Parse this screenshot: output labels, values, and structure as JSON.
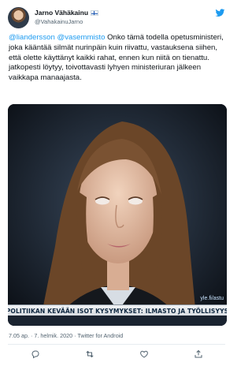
{
  "author": {
    "display_name": "Jarno Vähäkainu",
    "flag_icon": "finnish-flag-icon",
    "handle": "@VahakainuJarno"
  },
  "tweet": {
    "mention_1": "@liandersson",
    "mention_2": "@vasemmisto",
    "text": "Onko tämä todella opetusministeri, joka kääntää silmät nurinpäin kuin riivattu, vastauksena siihen, että olette käyttänyt kaikki rahat, ennen kun niitä on tienattu. jatkopesti löytyy, toivottavasti lyhyen ministeriuran jälkeen vaikkapa manaajasta."
  },
  "media": {
    "watermark": "yle.fi/astu",
    "ticker": "POLITIIKAN KEVÄÄN ISOT KYSYMYKSET: ILMASTO JA TYÖLLISYYS"
  },
  "meta": {
    "timestamp": "7.05 ap. · 7. helmik. 2020 · Twitter for Android"
  },
  "icons": {
    "brand": "twitter-bird-icon",
    "actions": [
      "reply-icon",
      "retweet-icon",
      "like-icon",
      "share-icon"
    ]
  },
  "colors": {
    "link": "#1d9bf0",
    "text": "#0f1419",
    "secondary": "#536471"
  }
}
